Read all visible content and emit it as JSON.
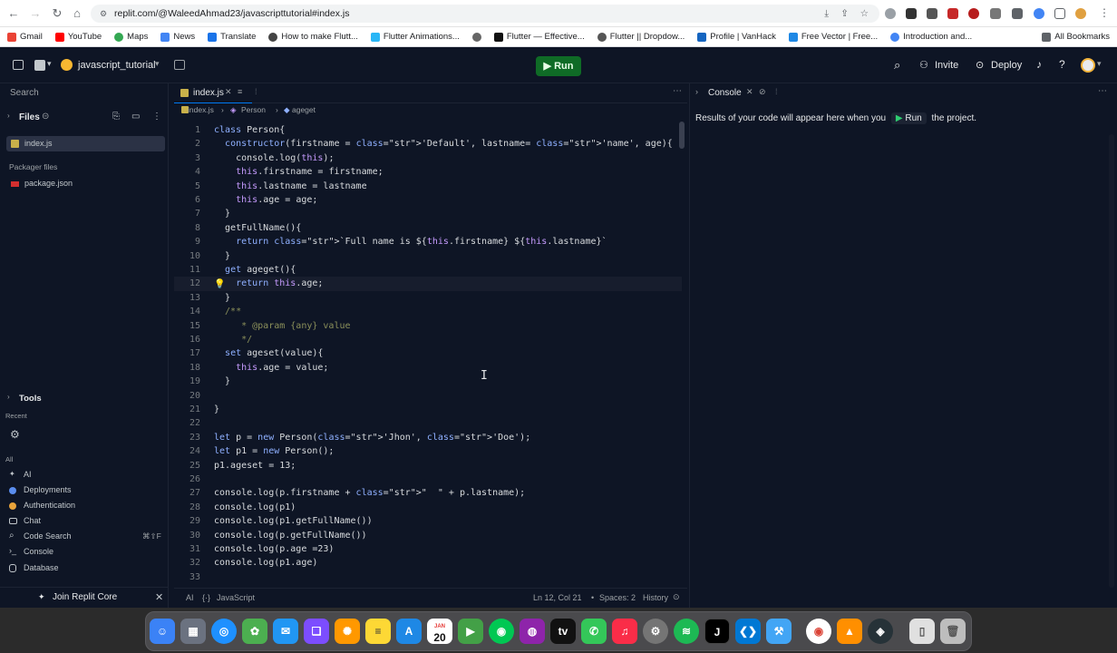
{
  "browser": {
    "url": "replit.com/@WaleedAhmad23/javascripttutorial#index.js",
    "bookmarks": [
      "Gmail",
      "YouTube",
      "Maps",
      "News",
      "Translate",
      "How to make Flutt...",
      "Flutter Animations...",
      "",
      "Flutter — Effective...",
      "Flutter || Dropdow...",
      "Profile | VanHack",
      "Free Vector | Free...",
      "Introduction and..."
    ],
    "all_bookmarks": "All Bookmarks"
  },
  "header": {
    "project_name": "javascript_tutorial",
    "run_label": "Run",
    "invite_label": "Invite",
    "deploy_label": "Deploy"
  },
  "sidebar": {
    "search_placeholder": "Search",
    "files_label": "Files",
    "active_file": "index.js",
    "packager_label": "Packager files",
    "package_file": "package.json",
    "tools_label": "Tools",
    "recent_label": "Recent",
    "all_label": "All",
    "tools": [
      "AI",
      "Deployments",
      "Authentication",
      "Chat",
      "Code Search",
      "Console",
      "Database"
    ],
    "code_search_shortcut": "⌘⇧F",
    "join_label": "Join Replit Core"
  },
  "editor": {
    "tab_name": "index.js",
    "breadcrumb": [
      "index.js",
      "Person",
      "ageget"
    ],
    "cursor_line": 12,
    "lines": [
      "class Person{",
      "  constructor(firstname = 'Default', lastname= 'name', age){",
      "    console.log(this);",
      "    this.firstname = firstname;",
      "    this.lastname = lastname",
      "    this.age = age;",
      "  }",
      "  getFullName(){",
      "    return `Full name is ${this.firstname} ${this.lastname}`",
      "  }",
      "  get ageget(){",
      "    return this.age;",
      "  }",
      "  /**",
      "     * @param {any} value",
      "     */",
      "  set ageset(value){",
      "    this.age = value;",
      "  }",
      "",
      "}",
      "",
      "let p = new Person('Jhon', 'Doe');",
      "let p1 = new Person();",
      "p1.ageset = 13;",
      "",
      "console.log(p.firstname + \"  \" + p.lastname);",
      "console.log(p1)",
      "console.log(p1.getFullName())",
      "console.log(p.getFullName())",
      "console.log(p.age =23)",
      "console.log(p1.age)",
      ""
    ],
    "status": {
      "ai": "AI",
      "language": "JavaScript",
      "position": "Ln 12, Col 21",
      "spaces": "Spaces: 2",
      "history": "History"
    }
  },
  "console": {
    "tab_name": "Console",
    "message_prefix": "Results of your code will appear here when you",
    "run_label": "Run",
    "message_suffix": "the project."
  },
  "dock": {
    "calendar_day": "20",
    "calendar_month": "JAN"
  }
}
